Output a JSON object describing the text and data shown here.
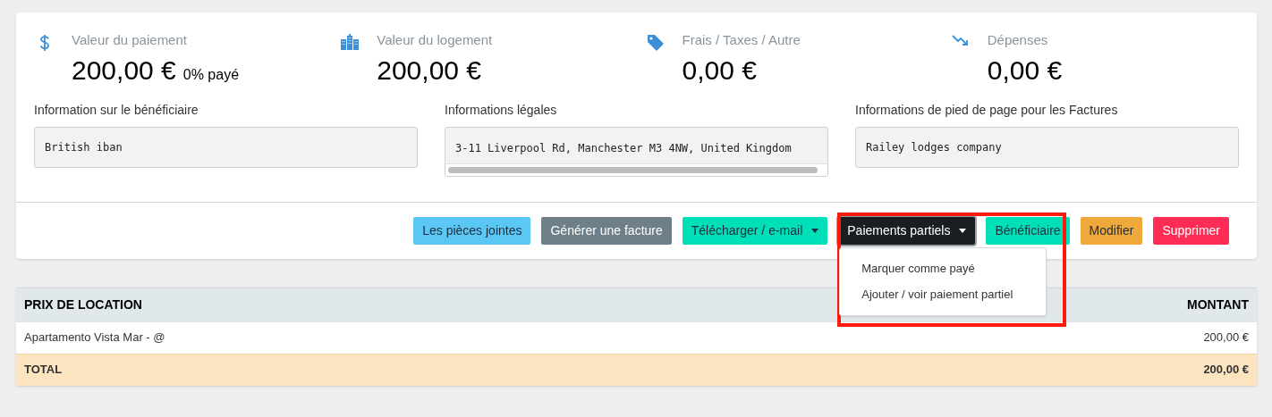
{
  "stats": [
    {
      "kind": "dollar",
      "label": "Valeur du paiement",
      "value": "200,00 €",
      "note": "0% payé"
    },
    {
      "kind": "building",
      "label": "Valeur du logement",
      "value": "200,00 €"
    },
    {
      "kind": "tag",
      "label": "Frais / Taxes / Autre",
      "value": "0,00 €"
    },
    {
      "kind": "trend",
      "label": "Dépenses",
      "value": "0,00 €"
    }
  ],
  "info_fields": [
    {
      "label": "Information sur le bénéficiaire",
      "value": "British iban",
      "scrollbar": false
    },
    {
      "label": "Informations légales",
      "value": "3-11 Liverpool Rd, Manchester M3 4NW, United Kingdom",
      "scrollbar": true
    },
    {
      "label": "Informations de pied de page pour les Factures",
      "value": "Railey lodges company",
      "scrollbar": false
    }
  ],
  "actions": [
    {
      "label": "Les pièces jointes",
      "kind": "info",
      "dropdown": false
    },
    {
      "label": "Générer une facture",
      "kind": "secondary",
      "dropdown": false
    },
    {
      "label": "Télécharger / e-mail",
      "kind": "success",
      "dropdown": true
    },
    {
      "label": "Paiements partiels",
      "kind": "dark",
      "dropdown": true,
      "expanded": true
    },
    {
      "label": "Bénéficiaire",
      "kind": "success",
      "dropdown": false
    },
    {
      "label": "Modifier",
      "kind": "warning",
      "dropdown": false
    },
    {
      "label": "Supprimer",
      "kind": "danger",
      "dropdown": false
    }
  ],
  "dropdown_menu": {
    "items": [
      "Marquer comme payé",
      "Ajouter / voir paiement partiel"
    ]
  },
  "highlight_box": true,
  "table": {
    "columns": [
      "PRIX DE LOCATION",
      "MONTANT"
    ],
    "rows": [
      {
        "cells": [
          "Apartamento Vista Mar - @",
          "200,00 €"
        ]
      }
    ],
    "total": [
      "TOTAL",
      "200,00 €"
    ]
  }
}
